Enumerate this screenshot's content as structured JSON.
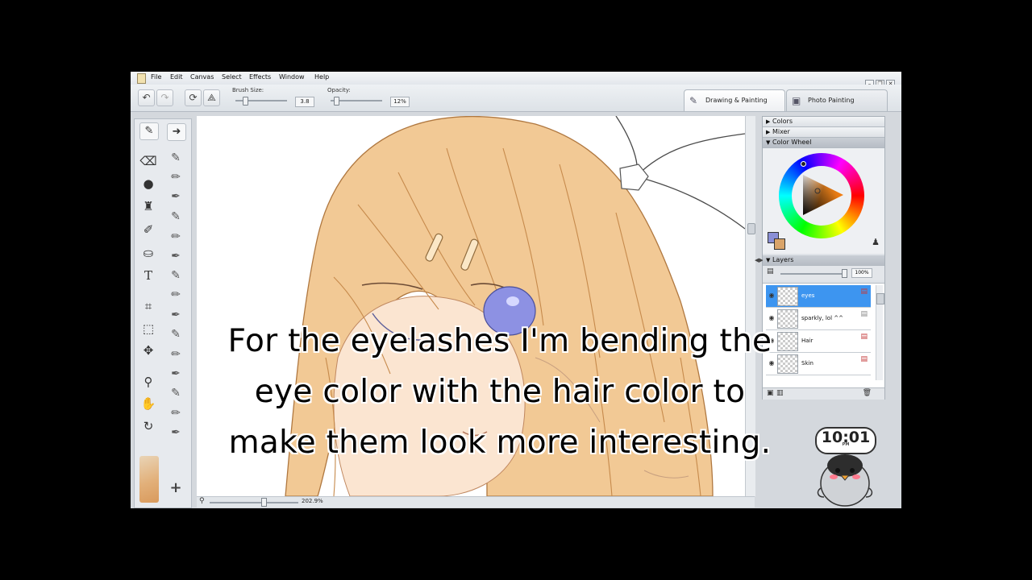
{
  "menu": [
    "File",
    "Edit",
    "Canvas",
    "Select",
    "Effects",
    "Window",
    "Help"
  ],
  "toolbar": {
    "brush_size_label": "Brush Size:",
    "brush_size_value": "3.8",
    "opacity_label": "Opacity:",
    "opacity_value": "12%"
  },
  "tabs": {
    "drawing": "Drawing & Painting",
    "photo": "Photo Painting"
  },
  "status": {
    "zoom": "202.9%"
  },
  "panels": {
    "colors": "Colors",
    "mixer": "Mixer",
    "color_wheel": "Color Wheel",
    "layers": "Layers",
    "layer_opacity": "100%"
  },
  "layers": [
    {
      "name": "eyes",
      "selected": true
    },
    {
      "name": "sparkly, lol ^^",
      "selected": false
    },
    {
      "name": "Hair",
      "selected": false
    },
    {
      "name": "Skin",
      "selected": false
    }
  ],
  "colors": {
    "main_color": "#8a8fd6",
    "secondary_color": "#d9a46a",
    "wheel_selected": "#c8711a"
  },
  "subtitle": "For the eyelashes I'm bending the eye color with the hair color to make them look more interesting.",
  "clock": {
    "time": "10:01",
    "ampm": "PM"
  }
}
